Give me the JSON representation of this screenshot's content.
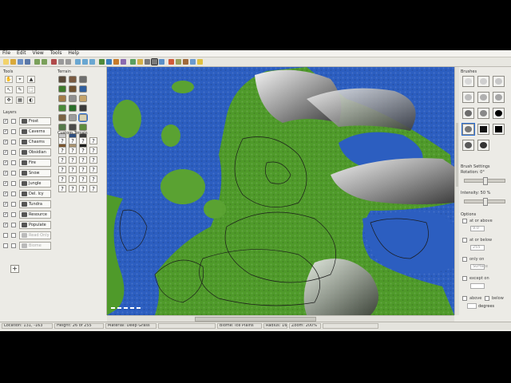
{
  "menu": [
    "File",
    "Edit",
    "View",
    "Tools",
    "Help"
  ],
  "left": {
    "tools_title": "Tools",
    "tools": [
      "✋",
      "⌖",
      "▲",
      "↖",
      "✎",
      "⬚",
      "✥",
      "▦",
      "◐"
    ],
    "terrain_title": "Terrain",
    "terrain_colors": [
      "#5a4a3a",
      "#7a5a40",
      "#6e6e6e",
      "#3e7b2c",
      "#6f5230",
      "#2f5f9e",
      "#a37c48",
      "#8f8f8f",
      "#c4a36a",
      "#4b8a3a",
      "#2a6f2a",
      "#3a3a3a",
      "#7b6342",
      "#9c9c9c",
      "#d9d2b4",
      "#567a4a",
      "#4a4a4a",
      "#5d8c3c",
      "#c6c6c6",
      "#2f4f7f",
      "#3a3a3a",
      "#7a5530",
      "#a89270",
      "#1f1f1f"
    ],
    "custom_title": "Custom Terrain",
    "custom_glyph": "?",
    "layers_title": "Layers",
    "layers": [
      {
        "label": "Frost",
        "enabled": true
      },
      {
        "label": "Caverns",
        "enabled": true
      },
      {
        "label": "Chasms",
        "enabled": true
      },
      {
        "label": "Obsidian",
        "enabled": true
      },
      {
        "label": "Fire",
        "enabled": true
      },
      {
        "label": "Snow",
        "enabled": true
      },
      {
        "label": "Jungle",
        "enabled": true
      },
      {
        "label": "Del. lcy",
        "enabled": true
      },
      {
        "label": "Tundra",
        "enabled": true
      },
      {
        "label": "Resource",
        "enabled": true
      },
      {
        "label": "Populate",
        "enabled": true
      },
      {
        "label": "Read Only",
        "enabled": false
      },
      {
        "label": "Biome",
        "enabled": false
      }
    ],
    "add_layer": "+"
  },
  "right": {
    "brushes_title": "Brushes",
    "brush_colors": [
      "#d8d8d8",
      "#cfcfcf",
      "#c8c8c8",
      "#bdbdbd",
      "#b0b0b0",
      "#a6a6a6",
      "#6c6c6c",
      "#888888",
      "#000000",
      "#777777",
      "#111111",
      "#000000",
      "#5a5a5a",
      "#333333"
    ],
    "brush_settings_title": "Brush Settings",
    "rotation_label": "Rotation: 0°",
    "rotation_value": 0.5,
    "intensity_label": "Intensity: 50 %",
    "intensity_value": 0.5,
    "options_title": "Options",
    "options": [
      {
        "label": "at or above",
        "value": "9.0"
      },
      {
        "label": "at or below",
        "value": "255"
      },
      {
        "label": "only on",
        "value": "Surface"
      },
      {
        "label": "except on",
        "value": ""
      }
    ],
    "above_label": "above",
    "below_label": "below",
    "degrees_label": "degrees"
  },
  "status": [
    "Location: 131, -163",
    "Height: 26 of 255",
    "Material: Deep Grass",
    "",
    "Biome: Ice Plains",
    "Radius: 16",
    "Zoom: 200%",
    ""
  ]
}
